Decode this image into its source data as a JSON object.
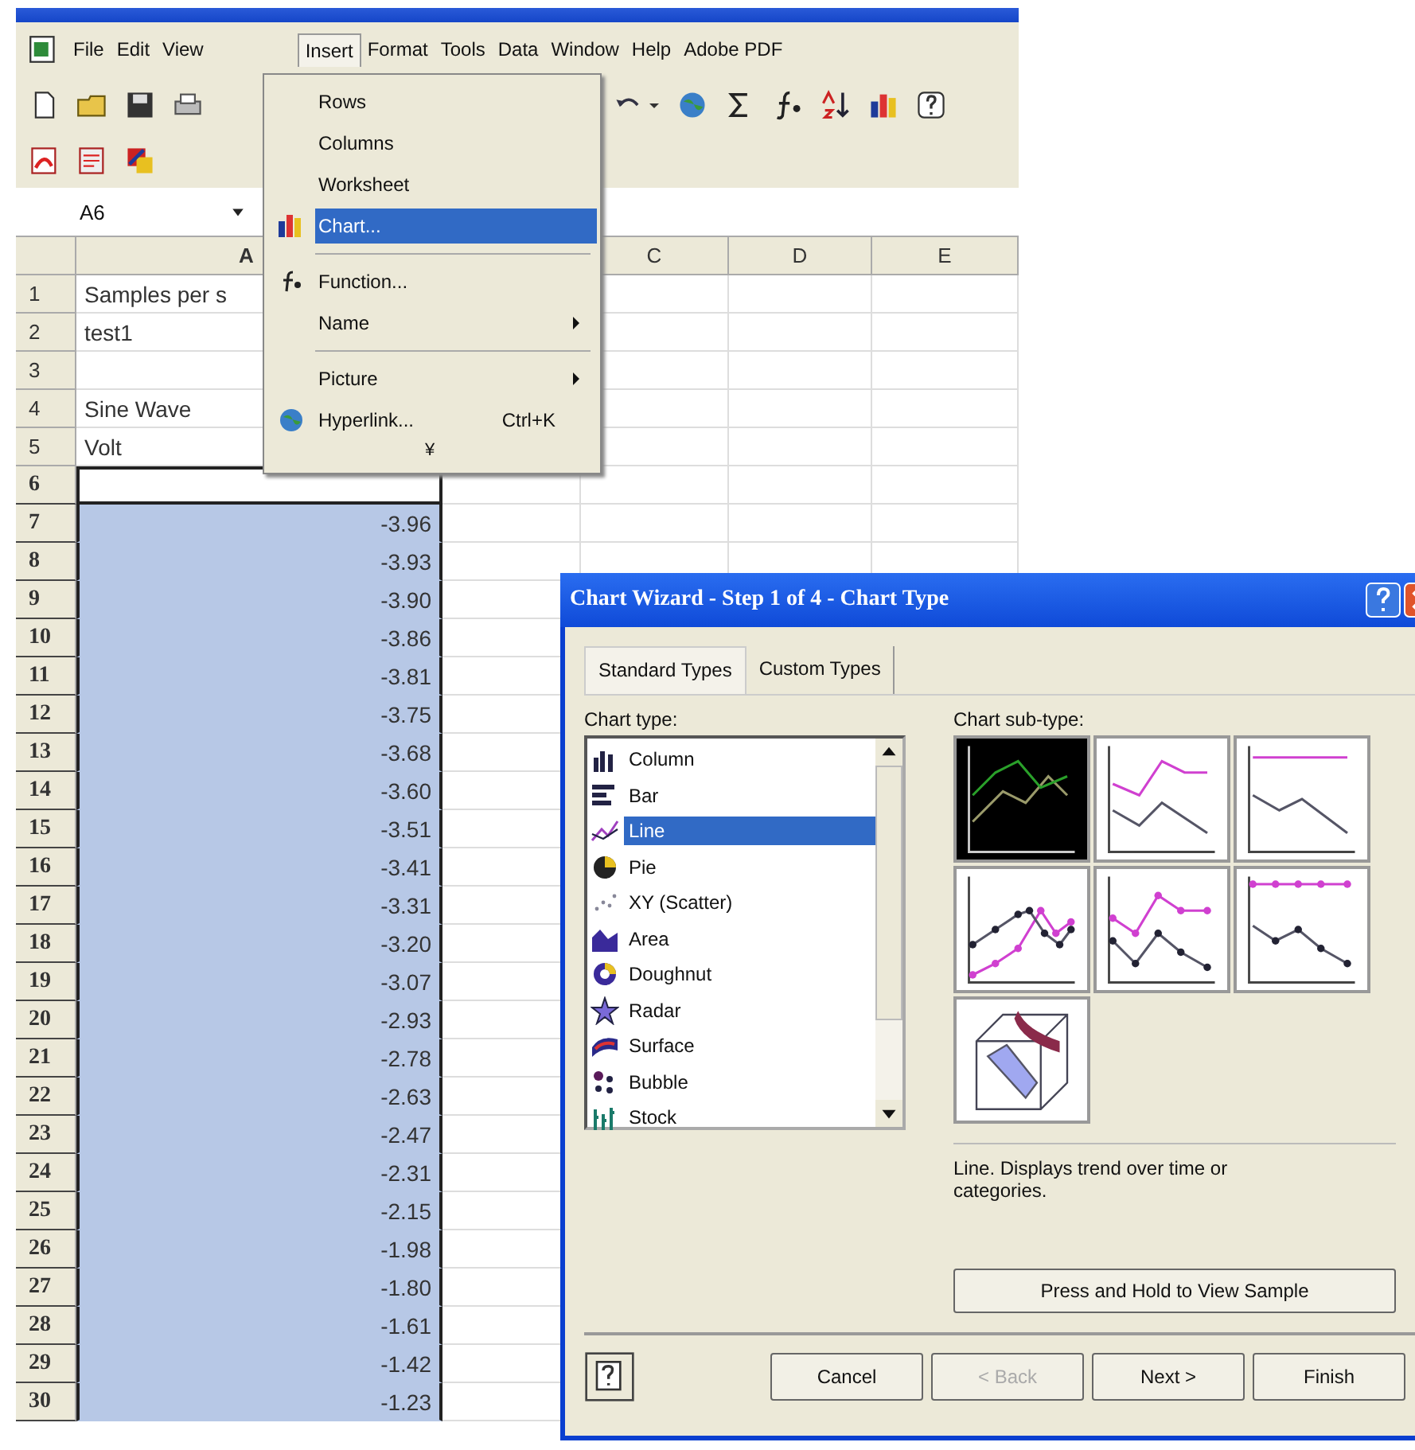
{
  "menu_bar": [
    {
      "label": "File",
      "selected": false
    },
    {
      "label": "Edit",
      "selected": false
    },
    {
      "label": "View",
      "selected": false
    },
    {
      "label": "Insert",
      "selected": true
    },
    {
      "label": "Format",
      "selected": false
    },
    {
      "label": "Tools",
      "selected": false
    },
    {
      "label": "Data",
      "selected": false
    },
    {
      "label": "Window",
      "selected": false
    },
    {
      "label": "Help",
      "selected": false
    },
    {
      "label": "Adobe PDF",
      "selected": false
    }
  ],
  "name_box": "A6",
  "columns": [
    "A",
    "C",
    "D",
    "E"
  ],
  "rows": [
    {
      "number": "1",
      "text": "Samples per s",
      "selected": false
    },
    {
      "number": "2",
      "text": "test1",
      "selected": false
    },
    {
      "number": "3",
      "selected": false
    },
    {
      "number": "4",
      "text": "Sine Wave",
      "selected": false
    },
    {
      "number": "5",
      "text": "Volt",
      "selected": false
    },
    {
      "number": "6",
      "selected": true,
      "active": true
    },
    {
      "number": "7",
      "value": "-3.96",
      "selected": true
    },
    {
      "number": "8",
      "value": "-3.93",
      "selected": true
    },
    {
      "number": "9",
      "value": "-3.90",
      "selected": true
    },
    {
      "number": "10",
      "value": "-3.86",
      "selected": true
    },
    {
      "number": "11",
      "value": "-3.81",
      "selected": true
    },
    {
      "number": "12",
      "value": "-3.75",
      "selected": true
    },
    {
      "number": "13",
      "value": "-3.68",
      "selected": true
    },
    {
      "number": "14",
      "value": "-3.60",
      "selected": true
    },
    {
      "number": "15",
      "value": "-3.51",
      "selected": true
    },
    {
      "number": "16",
      "value": "-3.41",
      "selected": true
    },
    {
      "number": "17",
      "value": "-3.31",
      "selected": true
    },
    {
      "number": "18",
      "value": "-3.20",
      "selected": true
    },
    {
      "number": "19",
      "value": "-3.07",
      "selected": true
    },
    {
      "number": "20",
      "value": "-2.93",
      "selected": true
    },
    {
      "number": "21",
      "value": "-2.78",
      "selected": true
    },
    {
      "number": "22",
      "value": "-2.63",
      "selected": true
    },
    {
      "number": "23",
      "value": "-2.47",
      "selected": true
    },
    {
      "number": "24",
      "value": "-2.31",
      "selected": true
    },
    {
      "number": "25",
      "value": "-2.15",
      "selected": true
    },
    {
      "number": "26",
      "value": "-1.98",
      "selected": true
    },
    {
      "number": "27",
      "value": "-1.80",
      "selected": true
    },
    {
      "number": "28",
      "value": "-1.61",
      "selected": true
    },
    {
      "number": "29",
      "value": "-1.42",
      "selected": true
    },
    {
      "number": "30",
      "value": "-1.23",
      "selected": true
    }
  ],
  "insert_menu": [
    {
      "kind": "item",
      "label": "Rows",
      "selected": false
    },
    {
      "kind": "item",
      "label": "Columns",
      "selected": false
    },
    {
      "kind": "item",
      "label": "Worksheet",
      "selected": false
    },
    {
      "kind": "item",
      "label": "Chart...",
      "selected": true
    },
    {
      "kind": "separator"
    },
    {
      "kind": "item",
      "label": "Function...",
      "selected": false
    },
    {
      "kind": "item",
      "label": "Name",
      "submenu": true,
      "selected": false
    },
    {
      "kind": "separator"
    },
    {
      "kind": "item",
      "label": "Picture",
      "submenu": true,
      "selected": false
    },
    {
      "kind": "item",
      "label": "Hyperlink...",
      "shortcut": "Ctrl+K",
      "selected": false
    },
    {
      "kind": "more",
      "label": "¥"
    }
  ],
  "dialog": {
    "title": "Chart Wizard - Step 1 of 4 - Chart Type",
    "tabs": [
      {
        "label": "Standard Types",
        "selected": true
      },
      {
        "label": "Custom Types",
        "selected": false
      }
    ],
    "chart_type_label": "Chart type:",
    "chart_types": [
      {
        "label": "Column",
        "selected": false
      },
      {
        "label": "Bar",
        "selected": false
      },
      {
        "label": "Line",
        "selected": true
      },
      {
        "label": "Pie",
        "selected": false
      },
      {
        "label": "XY (Scatter)",
        "selected": false
      },
      {
        "label": "Area",
        "selected": false
      },
      {
        "label": "Doughnut",
        "selected": false
      },
      {
        "label": "Radar",
        "selected": false
      },
      {
        "label": "Surface",
        "selected": false
      },
      {
        "label": "Bubble",
        "selected": false
      },
      {
        "label": "Stock",
        "selected": false
      }
    ],
    "subtype_label": "Chart sub-type:",
    "subtypes": [
      {
        "kind": "line",
        "selected": true
      },
      {
        "kind": "stacked",
        "selected": false
      },
      {
        "kind": "percent",
        "selected": false
      },
      {
        "kind": "line_markers",
        "selected": false
      },
      {
        "kind": "stacked_markers",
        "selected": false
      },
      {
        "kind": "percent_markers",
        "selected": false
      },
      {
        "kind": "ribbon",
        "selected": false
      }
    ],
    "description": "Line. Displays trend over time or categories.",
    "sample_button": "Press and Hold to View Sample",
    "buttons": [
      {
        "label": "Cancel",
        "disabled": false
      },
      {
        "label": "< Back",
        "disabled": true
      },
      {
        "label": "Next >",
        "disabled": false
      },
      {
        "label": "Finish",
        "disabled": false
      }
    ]
  }
}
